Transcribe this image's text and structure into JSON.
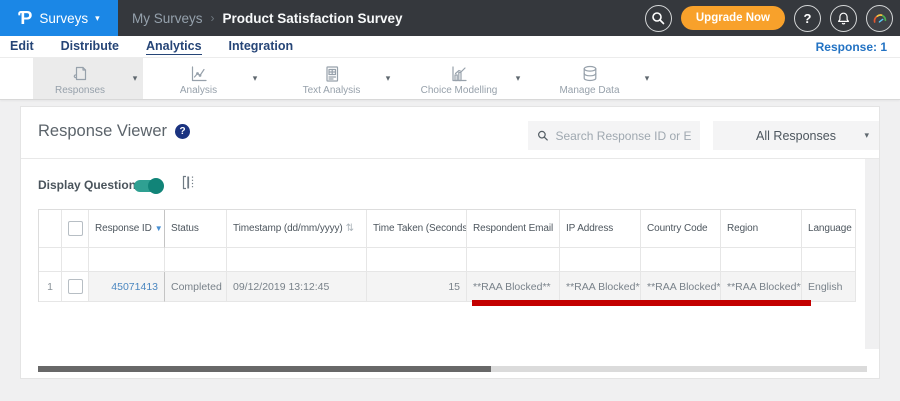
{
  "topbar": {
    "logo_glyph": "Ƥ",
    "app_menu_label": "Surveys",
    "breadcrumb": {
      "parent": "My Surveys",
      "separator": "›",
      "current": "Product Satisfaction Survey"
    },
    "upgrade_button": "Upgrade Now",
    "help_glyph": "?",
    "icons": [
      "search-icon",
      "help-icon",
      "bell-icon",
      "avatar-gauge-icon"
    ]
  },
  "nav_tabs": {
    "items": [
      "Edit",
      "Distribute",
      "Analytics",
      "Integration"
    ],
    "active": "Analytics",
    "response_count": "Response: 1"
  },
  "toolbar": {
    "items": [
      {
        "label": "Responses",
        "icon": "responses-icon",
        "active": true
      },
      {
        "label": "Analysis",
        "icon": "analysis-icon",
        "active": false
      },
      {
        "label": "Text Analysis",
        "icon": "text-analysis-icon",
        "active": false
      },
      {
        "label": "Choice Modelling",
        "icon": "choice-modelling-icon",
        "active": false
      },
      {
        "label": "Manage Data",
        "icon": "manage-data-icon",
        "active": false
      }
    ]
  },
  "viewer": {
    "title": "Response Viewer",
    "help_glyph": "?",
    "search_placeholder": "Search Response ID or Email",
    "responses_filter": "All Responses",
    "display_questions_label": "Display Questions",
    "display_questions_on": true
  },
  "table": {
    "columns": [
      {
        "label": "",
        "type": "rownum"
      },
      {
        "label": "",
        "type": "checkbox"
      },
      {
        "label": "Response ID",
        "sort": "desc"
      },
      {
        "label": "Status"
      },
      {
        "label": "Timestamp (dd/mm/yyyy)",
        "sort": "both"
      },
      {
        "label": "Time Taken (Seconds)",
        "sort": "both"
      },
      {
        "label": "Respondent Email"
      },
      {
        "label": "IP Address"
      },
      {
        "label": "Country Code"
      },
      {
        "label": "Region"
      },
      {
        "label": "Language"
      }
    ],
    "rows": [
      {
        "rownum": "1",
        "checked": false,
        "cells": [
          "45071413",
          "Completed",
          "09/12/2019 13:12:45",
          "15",
          "**RAA Blocked**",
          "**RAA Blocked**",
          "**RAA Blocked**",
          "**RAA Blocked**",
          "English"
        ]
      }
    ],
    "annotation": {
      "type": "red-underline",
      "spans_columns": [
        "Respondent Email",
        "IP Address",
        "Country Code",
        "Region"
      ]
    }
  },
  "colors": {
    "accent_blue": "#1B87E6",
    "topbar_dark": "#35383D",
    "upgrade_orange": "#F8A12B",
    "navy_tab": "#264577",
    "toggle_teal": "#2FA092",
    "annotation_red": "#C30000",
    "link_blue": "#4B87C0"
  }
}
